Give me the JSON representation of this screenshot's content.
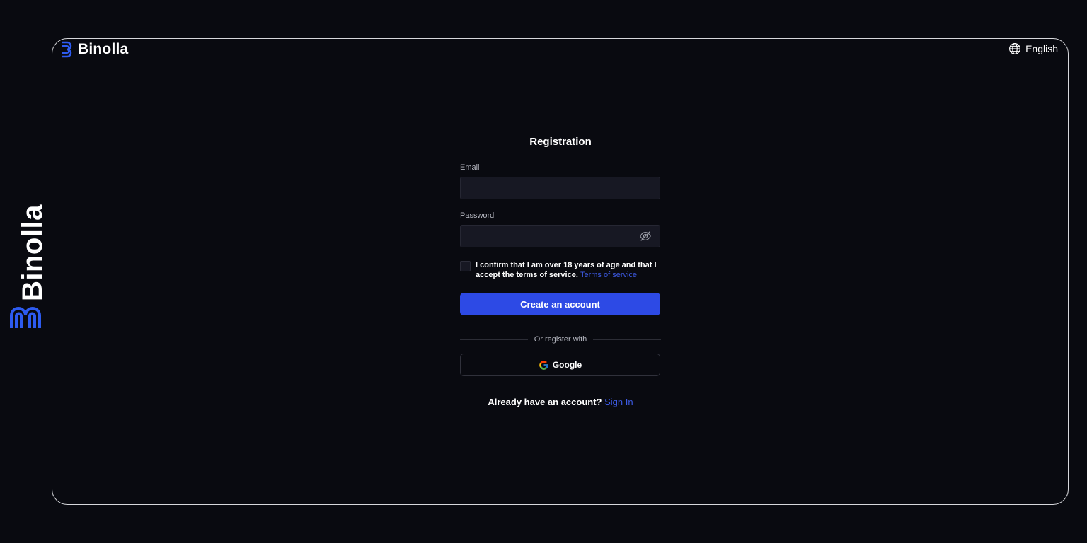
{
  "brand": {
    "name": "Binolla",
    "side_name": "Binolla",
    "accent_color": "#2d4ae5",
    "logo_icon": "binolla-logo-icon"
  },
  "header": {
    "language": "English",
    "language_icon": "globe-icon"
  },
  "form": {
    "title": "Registration",
    "email_label": "Email",
    "email_value": "",
    "password_label": "Password",
    "password_value": "",
    "password_toggle_icon": "eye-off-icon",
    "consent_text": "I confirm that I am over 18 years of age and that I accept the terms of service.",
    "terms_link": "Terms of service",
    "consent_checked": false,
    "create_button": "Create an account",
    "divider_text": "Or register with",
    "google_button": "Google",
    "google_icon": "google-icon",
    "signin_prompt": "Already have an account?",
    "signin_link": "Sign In"
  }
}
